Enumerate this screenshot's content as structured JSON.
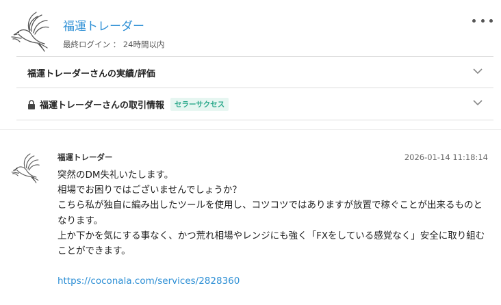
{
  "profile": {
    "name": "福運トレーダー",
    "last_login": "最終ログイン ： 24時間以内",
    "more_icon": "more-horizontal-icon"
  },
  "sections": [
    {
      "title": "福運トレーダーさんの実績/評価",
      "icon": "chevron-down-icon"
    },
    {
      "title": "福運トレーダーさんの取引情報",
      "badge": "セラーサクセス",
      "lock_icon": "lock-icon",
      "icon": "chevron-down-icon"
    }
  ],
  "message": {
    "sender": "福運トレーダー",
    "timestamp": "2026-01-14 11:18:14",
    "lines": [
      "突然のDM失礼いたします。",
      "相場でお困りではございませんでしょうか？",
      "こちら私が独自に編み出したツールを使用し、コツコツではありますが放置で稼ぐことが出来るものとなります。",
      "上か下かを気にする事なく、かつ荒れ相場やレンジにも強く「FXをしている感覚なく」安全に取り組むことができます。"
    ],
    "link": "https://coconala.com/services/2828360"
  },
  "colors": {
    "link": "#2d8fd5",
    "badge_text": "#2aa88a",
    "badge_bg": "#e6f6f1",
    "divider": "#dcdcdc"
  }
}
